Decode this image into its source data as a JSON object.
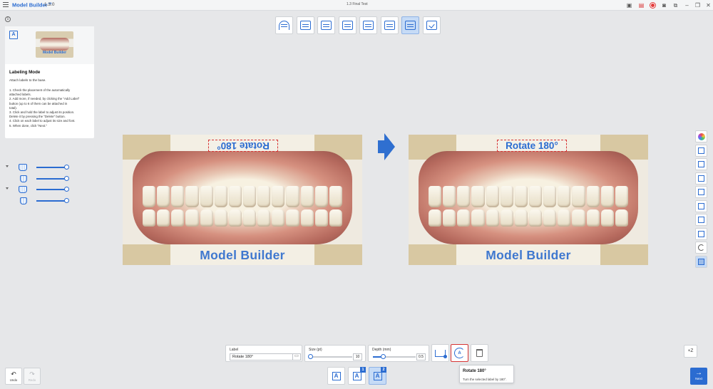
{
  "titlebar": {
    "app_name": "Model Builder",
    "app_sup": "3S",
    "version": "1.3.0",
    "window_title": "1.3 Final Test"
  },
  "guide": {
    "thumb_label": "Model Builder",
    "title": "Labeling Mode",
    "description": "Attach labels to the base.",
    "steps": [
      "1. Check the placement of the automatically",
      "    attached labels.",
      "2. Add more, if needed, by clicking the \"Add Label\"",
      "    button (up to 6 of them can be attached in",
      "    total).",
      "3. Click and hold the label to adjust its position.",
      "    Delete it by pressing the \"Delete\" button.",
      "4. Click on each label to adjust its size and font.",
      "5. When done, click \"Next.\""
    ]
  },
  "model": {
    "label_text": "Rotate 180°",
    "brand_text": "Model Builder"
  },
  "props": {
    "label_caption": "Label",
    "label_value": "Rotate 180°",
    "size_caption": "Size (pt)",
    "size_value": "10",
    "depth_caption": "Depth (mm)",
    "depth_value": "0.5"
  },
  "tooltip": {
    "title": "Rotate 180°",
    "description": "Turn the selected label by 180°."
  },
  "controls": {
    "z_label": "+Z",
    "undo_label": "Undo",
    "redo_label": "Redo",
    "next_label": "Next"
  },
  "label_bar": {
    "badge_1": "1",
    "badge_2": "2"
  },
  "colors": {
    "accent": "#2b6cd1",
    "highlight": "#d63434"
  }
}
